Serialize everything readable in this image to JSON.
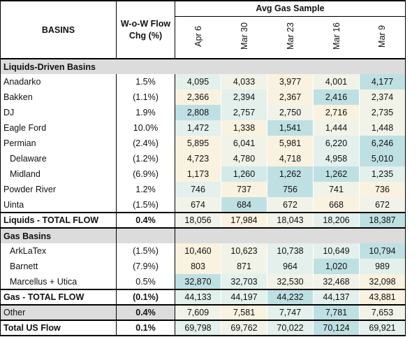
{
  "header": {
    "basins_label": "BASINS",
    "chg_label_line1": "W-o-W Flow",
    "chg_label_line2": "Chg (%)",
    "avg_label": "Avg Gas Sample",
    "dates": [
      "Apr 6",
      "Mar 30",
      "Mar 23",
      "Mar 16",
      "Mar 9"
    ]
  },
  "sections": {
    "liquids_title": "Liquids-Driven Basins",
    "gas_title": "Gas Basins"
  },
  "liquids_rows": [
    {
      "name": "Anadarko",
      "chg": "1.5%",
      "values": [
        "4,095",
        "4,033",
        "3,977",
        "4,001",
        "4,177"
      ]
    },
    {
      "name": "Bakken",
      "chg": "(1.1%)",
      "values": [
        "2,366",
        "2,394",
        "2,367",
        "2,416",
        "2,374"
      ]
    },
    {
      "name": "DJ",
      "chg": "1.9%",
      "values": [
        "2,808",
        "2,757",
        "2,750",
        "2,716",
        "2,735"
      ]
    },
    {
      "name": "Eagle Ford",
      "chg": "10.0%",
      "values": [
        "1,472",
        "1,338",
        "1,541",
        "1,444",
        "1,448"
      ]
    },
    {
      "name": "Permian",
      "chg": "(2.4%)",
      "values": [
        "5,895",
        "6,041",
        "5,981",
        "6,220",
        "6,246"
      ]
    },
    {
      "name": "Delaware",
      "chg": "(1.2%)",
      "values": [
        "4,723",
        "4,780",
        "4,718",
        "4,958",
        "5,010"
      ]
    },
    {
      "name": "Midland",
      "chg": "(6.9%)",
      "values": [
        "1,173",
        "1,260",
        "1,262",
        "1,262",
        "1,235"
      ]
    },
    {
      "name": "Powder River",
      "chg": "1.2%",
      "values": [
        "746",
        "737",
        "756",
        "741",
        "736"
      ]
    },
    {
      "name": "Uinta",
      "chg": "(1.5%)",
      "values": [
        "674",
        "684",
        "672",
        "668",
        "672"
      ]
    }
  ],
  "liquids_total": {
    "name": "Liquids - TOTAL FLOW",
    "chg": "0.4%",
    "values": [
      "18,056",
      "17,984",
      "18,043",
      "18,206",
      "18,387"
    ]
  },
  "gas_rows": [
    {
      "name": "ArkLaTex",
      "chg": "(1.5%)",
      "values": [
        "10,460",
        "10,623",
        "10,738",
        "10,649",
        "10,794"
      ]
    },
    {
      "name": "Barnett",
      "chg": "(7.9%)",
      "values": [
        "803",
        "871",
        "964",
        "1,020",
        "989"
      ]
    },
    {
      "name": "Marcellus + Utica",
      "chg": "0.5%",
      "values": [
        "32,870",
        "32,703",
        "32,530",
        "32,468",
        "32,098"
      ]
    }
  ],
  "gas_total": {
    "name": "Gas - TOTAL FLOW",
    "chg": "(0.1%)",
    "values": [
      "44,133",
      "44,197",
      "44,232",
      "44,137",
      "43,881"
    ]
  },
  "other_row": {
    "name": "Other",
    "chg": "0.4%",
    "values": [
      "7,609",
      "7,581",
      "7,747",
      "7,781",
      "7,653"
    ]
  },
  "us_total": {
    "name": "Total US Flow",
    "chg": "0.1%",
    "values": [
      "69,798",
      "69,762",
      "70,022",
      "70,124",
      "69,921"
    ]
  },
  "colors": {
    "teal_strong": "#bfe0e3",
    "teal_mid": "#d3eaea",
    "teal_light": "#e3f0ec",
    "cream_light": "#f2f3e8",
    "cream": "#faf2e0",
    "section_gray": "#dcdcdc"
  },
  "heat": {
    "liquids_rows": [
      [
        "teal_light",
        "cream_light",
        "cream",
        "cream_light",
        "teal_strong"
      ],
      [
        "cream",
        "teal_light",
        "cream",
        "teal_strong",
        "cream_light"
      ],
      [
        "teal_strong",
        "teal_light",
        "cream_light",
        "cream",
        "cream_light"
      ],
      [
        "teal_light",
        "cream",
        "teal_strong",
        "cream_light",
        "cream_light"
      ],
      [
        "cream",
        "cream_light",
        "cream",
        "teal_light",
        "teal_strong"
      ],
      [
        "cream",
        "cream_light",
        "cream",
        "teal_light",
        "teal_strong"
      ],
      [
        "cream",
        "teal_mid",
        "teal_strong",
        "teal_strong",
        "teal_light"
      ],
      [
        "teal_light",
        "cream",
        "teal_strong",
        "cream_light",
        "cream"
      ],
      [
        "cream_light",
        "teal_strong",
        "cream_light",
        "cream",
        "cream_light"
      ]
    ],
    "liquids_total": [
      "cream_light",
      "cream",
      "cream_light",
      "teal_light",
      "teal_strong"
    ],
    "gas_rows": [
      [
        "cream",
        "cream_light",
        "teal_light",
        "teal_light",
        "teal_strong"
      ],
      [
        "cream",
        "cream_light",
        "teal_light",
        "teal_strong",
        "teal_light"
      ],
      [
        "teal_strong",
        "teal_light",
        "cream_light",
        "cream_light",
        "cream"
      ]
    ],
    "gas_total": [
      "teal_light",
      "teal_light",
      "teal_strong",
      "teal_light",
      "cream"
    ],
    "other_row": [
      "cream_light",
      "cream",
      "teal_light",
      "teal_strong",
      "cream_light"
    ],
    "us_total": [
      "teal_light",
      "cream_light",
      "teal_light",
      "teal_strong",
      "teal_light"
    ]
  }
}
